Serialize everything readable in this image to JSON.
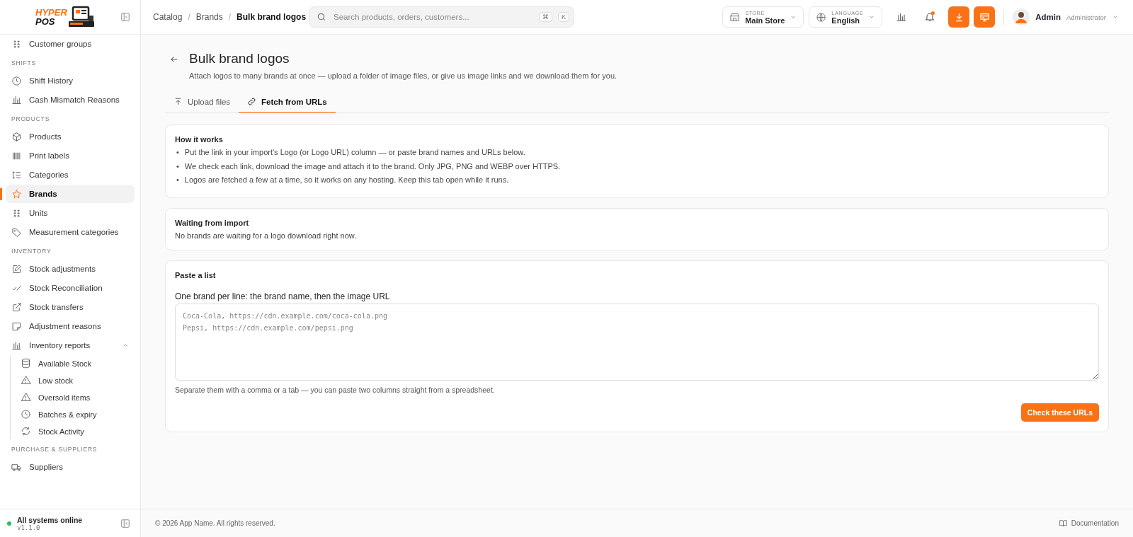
{
  "sidebar": {
    "logo": {
      "line_1": "HYPER",
      "line_2": "POS"
    },
    "sections": [
      {
        "items": [
          {
            "label": "Customer groups",
            "selected": false
          }
        ]
      },
      {
        "title": "SHIFTS",
        "items": [
          {
            "label": "Shift History",
            "selected": false
          },
          {
            "label": "Cash Mismatch Reasons",
            "selected": false
          }
        ]
      },
      {
        "title": "PRODUCTS",
        "items": [
          {
            "label": "Products",
            "selected": false
          },
          {
            "label": "Print labels",
            "selected": false
          },
          {
            "label": "Categories",
            "selected": false
          },
          {
            "label": "Brands",
            "selected": true
          },
          {
            "label": "Units",
            "selected": false
          },
          {
            "label": "Measurement categories",
            "selected": false
          }
        ]
      },
      {
        "title": "INVENTORY",
        "items": [
          {
            "label": "Stock adjustments",
            "selected": false
          },
          {
            "label": "Stock Reconciliation",
            "selected": false
          },
          {
            "label": "Stock transfers",
            "selected": false
          },
          {
            "label": "Adjustment reasons",
            "selected": false
          },
          {
            "label": "Inventory reports",
            "selected": false,
            "expanded": true,
            "children": [
              {
                "label": "Available Stock",
                "selected": false
              },
              {
                "label": "Low stock",
                "selected": false
              },
              {
                "label": "Oversold items",
                "selected": false
              },
              {
                "label": "Batches & expiry",
                "selected": false
              },
              {
                "label": "Stock Activity",
                "selected": false
              }
            ]
          }
        ]
      },
      {
        "title": "PURCHASE & SUPPLIERS",
        "items": [
          {
            "label": "Suppliers",
            "selected": false
          }
        ]
      }
    ],
    "status": {
      "label": "All systems online",
      "version": "v1.1.0",
      "online": true
    }
  },
  "breadcrumbs": [
    {
      "kind": "link",
      "label": "Catalog"
    },
    {
      "kind": "separator",
      "label": "/"
    },
    {
      "kind": "link",
      "label": "Brands"
    },
    {
      "kind": "separator",
      "label": "/"
    },
    {
      "kind": "current",
      "label": "Bulk brand logos"
    }
  ],
  "search": {
    "placeholder": "Search products, orders, customers...",
    "shortcut_keys": [
      "⌘",
      "K"
    ]
  },
  "store_selector": {
    "label": "STORE",
    "value": "Main Store"
  },
  "language_selector": {
    "label": "LANGUAGE",
    "value": "English"
  },
  "notifications": {
    "unread": true
  },
  "user": {
    "name": "Admin",
    "role": "Administrator"
  },
  "page": {
    "title": "Bulk brand logos",
    "subtitle": "Attach logos to many brands at once — upload a folder of image files, or give us image links and we download them for you."
  },
  "tabs": [
    {
      "label": "Upload files",
      "selected": false
    },
    {
      "label": "Fetch from URLs",
      "selected": true
    }
  ],
  "how_it_works": {
    "title": "How it works",
    "bullets": [
      {
        "marker": "•",
        "text": "Put the link in your import's Logo (or Logo URL) column — or paste brand names and URLs below."
      },
      {
        "marker": "•",
        "text": "We check each link, download the image and attach it to the brand. Only JPG, PNG and WEBP over HTTPS."
      },
      {
        "marker": "•",
        "text": "Logos are fetched a few at a time, so it works on any hosting. Keep this tab open while it runs."
      }
    ]
  },
  "waiting": {
    "title": "Waiting from import",
    "message": "No brands are waiting for a logo download right now."
  },
  "paste_list": {
    "title": "Paste a list",
    "field_label": "One brand per line: the brand name, then the image URL",
    "placeholder": "Coca-Cola, https://cdn.example.com/coca-cola.png\nPepsi, https://cdn.example.com/pepsi.png",
    "hint": "Separate them with a comma or a tab — you can paste two columns straight from a spreadsheet.",
    "button": "Check these URLs"
  },
  "footer": {
    "copyright": "© 2026 App Name. All rights reserved.",
    "documentation": "Documentation"
  }
}
